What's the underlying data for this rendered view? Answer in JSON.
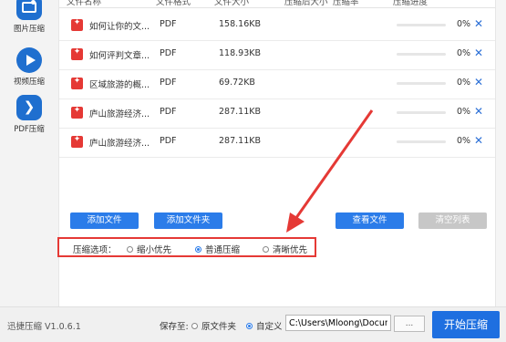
{
  "sidebar": {
    "items": [
      {
        "label": "图片压缩",
        "icon": "image-icon"
      },
      {
        "label": "视频压缩",
        "icon": "play-icon"
      },
      {
        "label": "PDF压缩",
        "icon": "pdf-icon",
        "active": true
      }
    ]
  },
  "table": {
    "headers": [
      "文件名称",
      "文件格式",
      "文件大小",
      "压缩后大小",
      "压缩率",
      "压缩进度"
    ],
    "rows": [
      {
        "name": "如何让你的文...",
        "format": "PDF",
        "size": "158.16KB",
        "progress": 0,
        "pct": "0%"
      },
      {
        "name": "如何评判文章...",
        "format": "PDF",
        "size": "118.93KB",
        "progress": 0,
        "pct": "0%"
      },
      {
        "name": "区域旅游的概...",
        "format": "PDF",
        "size": "69.72KB",
        "progress": 0,
        "pct": "0%"
      },
      {
        "name": "庐山旅游经济...",
        "format": "PDF",
        "size": "287.11KB",
        "progress": 0,
        "pct": "0%"
      },
      {
        "name": "庐山旅游经济...",
        "format": "PDF",
        "size": "287.11KB",
        "progress": 0,
        "pct": "0%"
      }
    ],
    "delete_glyph": "✕"
  },
  "actions": {
    "add_file": "添加文件",
    "add_folder": "添加文件夹",
    "view_file": "查看文件",
    "clear_list": "清空列表"
  },
  "options": {
    "label": "压缩选项：",
    "choices": [
      "缩小优先",
      "普通压缩",
      "清晰优先"
    ],
    "selected": "普通压缩"
  },
  "footer": {
    "version": "迅捷压缩 V1.0.6.1",
    "save_label": "保存至:",
    "save_choices": [
      "原文件夹",
      "自定义"
    ],
    "save_selected": "自定义",
    "path": "C:\\Users\\Mloong\\Documents",
    "browse": "...",
    "start": "开始压缩"
  },
  "colors": {
    "accent": "#2b7ce9",
    "highlight": "#e53935",
    "pdf_red": "#e53935"
  }
}
